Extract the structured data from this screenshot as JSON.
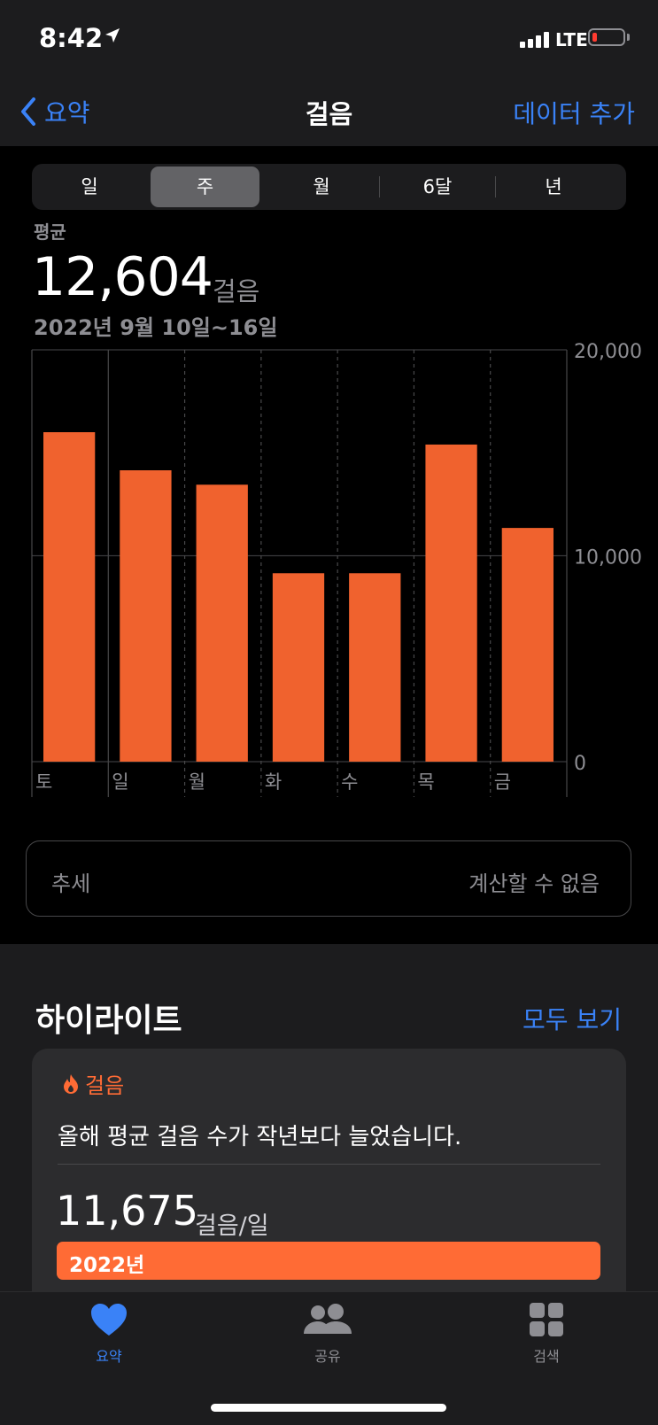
{
  "status": {
    "time": "8:42",
    "network": "LTE"
  },
  "nav": {
    "back_label": "요약",
    "title": "걸음",
    "action_label": "데이터 추가"
  },
  "segments": {
    "items": [
      "일",
      "주",
      "월",
      "6달",
      "년"
    ],
    "selected": "주"
  },
  "summary": {
    "avg_label": "평균",
    "avg_value": "12,604",
    "avg_unit": "걸음",
    "date_range": "2022년 9월 10일~16일"
  },
  "chart_data": {
    "type": "bar",
    "categories": [
      "토",
      "일",
      "월",
      "화",
      "수",
      "목",
      "금"
    ],
    "values": [
      16000,
      14150,
      13450,
      9150,
      9150,
      15400,
      11350
    ],
    "ylim": [
      0,
      20000
    ],
    "yticks": [
      "20,000",
      "10,000",
      "0"
    ],
    "bar_color": "#f0622e"
  },
  "trend": {
    "label": "추세",
    "value": "계산할 수 없음"
  },
  "highlights": {
    "title": "하이라이트",
    "see_all": "모두 보기",
    "card": {
      "category": "걸음",
      "text": "올해 평균 걸음 수가 작년보다 늘었습니다.",
      "value": "11,675",
      "unit": "걸음/일",
      "bar_label": "2022년"
    }
  },
  "tabbar": {
    "items": [
      "요약",
      "공유",
      "검색"
    ],
    "active": "요약",
    "active_color": "#3a82f7"
  }
}
